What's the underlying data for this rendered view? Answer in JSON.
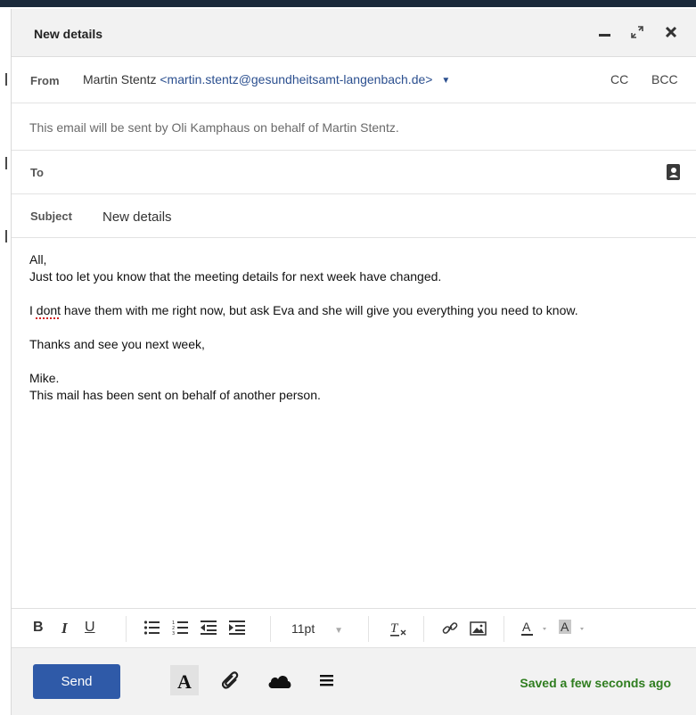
{
  "window": {
    "title": "New details"
  },
  "header": {
    "from_label": "From",
    "from_name": "Martin Stentz",
    "from_email": "<martin.stentz@gesundheitsamt-langenbach.de>",
    "cc_label": "CC",
    "bcc_label": "BCC",
    "notice": "This email will be sent by Oli Kamphaus on behalf of Martin Stentz.",
    "to_label": "To",
    "subject_label": "Subject",
    "subject_value": "New details"
  },
  "body": {
    "greeting": "All,",
    "line1": "Just too let you know that the meeting details for next week have changed.",
    "line2_misspelled": "dont",
    "line2_pre": "I ",
    "line2_post": " have them with me right now, but ask Eva and she will give you everything you need to know.",
    "line3": "Thanks and see you next week,",
    "sign": "Mike.",
    "footer_line": "This mail has been sent on behalf of another person."
  },
  "toolbar": {
    "bold": "B",
    "italic": "I",
    "underline": "U",
    "font_size": "11pt"
  },
  "footer": {
    "send_label": "Send",
    "status": "Saved a few seconds ago"
  },
  "colors": {
    "accent": "#2f5aa8",
    "saved_green": "#2f7d1f",
    "link_blue": "#2b4f8f"
  }
}
